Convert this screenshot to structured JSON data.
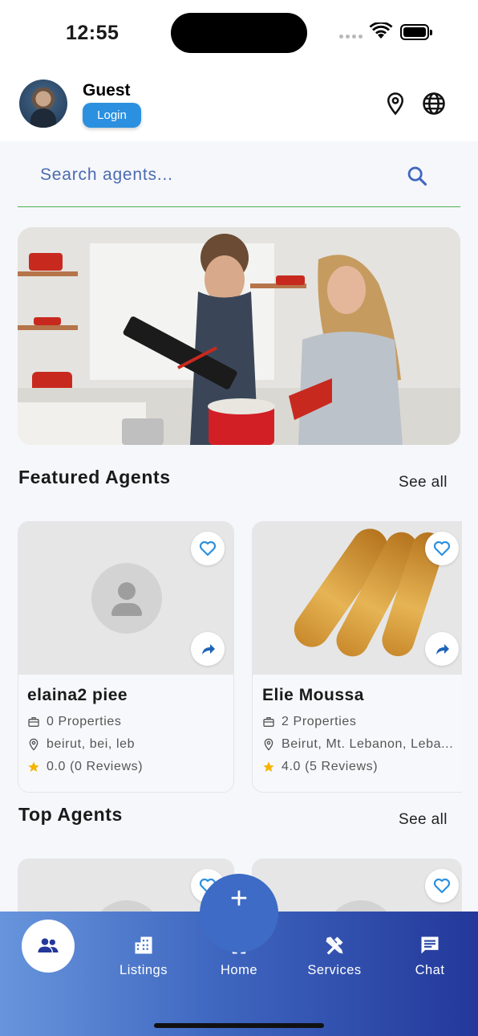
{
  "status_bar": {
    "time": "12:55"
  },
  "header": {
    "user_name": "Guest",
    "login_label": "Login",
    "icons": [
      "location-pin-icon",
      "globe-icon"
    ]
  },
  "search": {
    "placeholder": "Search agents..."
  },
  "sections": {
    "featured": {
      "title": "Featured Agents",
      "see_all": "See all"
    },
    "top": {
      "title": "Top Agents",
      "see_all": "See all"
    }
  },
  "featured_agents": [
    {
      "name": "elaina2 piee",
      "properties": "0 Properties",
      "location": "beirut, bei, leb",
      "rating": "0.0 (0 Reviews)"
    },
    {
      "name": "Elie Moussa",
      "properties": "2 Properties",
      "location": "Beirut, Mt. Lebanon, Leba...",
      "rating": "4.0 (5 Reviews)"
    }
  ],
  "bottom_nav": {
    "items": [
      {
        "label": "Listings",
        "icon": "building-icon"
      },
      {
        "label": "Home",
        "icon": "home-icon"
      },
      {
        "label": "Services",
        "icon": "tools-icon"
      },
      {
        "label": "Chat",
        "icon": "chat-icon"
      }
    ],
    "active_icon": "people-icon",
    "fab_label": "+"
  },
  "colors": {
    "accent": "#2b90e0",
    "search_underline": "#4caf50",
    "star": "#f5b400",
    "nav_start": "#6795dc",
    "nav_end": "#23389a"
  }
}
